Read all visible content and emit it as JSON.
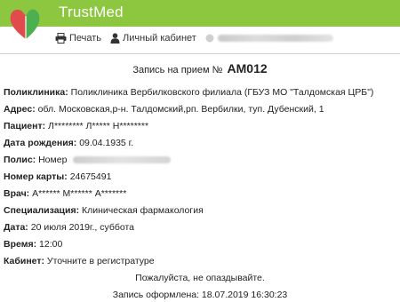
{
  "header": {
    "app_title": "TrustMed",
    "brand_color": "#8dc63f",
    "logo": {
      "icon": "heart-leaf-logo"
    }
  },
  "toolbar": {
    "print_label": "Печать",
    "print_icon": "printer-icon",
    "cabinet_label": "Личный кабинет",
    "cabinet_icon": "person-icon"
  },
  "appointment": {
    "title_prefix": "Запись на прием №",
    "number": "AM012",
    "fields": {
      "clinic_label": "Поликлиника:",
      "clinic_value": "Поликлиника Вербилковского филиала (ГБУЗ МО \"Талдомская ЦРБ\")",
      "address_label": "Адрес:",
      "address_value": "обл. Московская,р-н. Талдомский,рп. Вербилки, туп. Дубенский, 1",
      "patient_label": "Пациент:",
      "patient_value": "Л******** Л***** Н********",
      "birth_label": "Дата рождения:",
      "birth_value": "09.04.1935 г.",
      "policy_label": "Полис:",
      "policy_value": "Номер",
      "card_label": "Номер карты:",
      "card_value": "24675491",
      "doctor_label": "Врач:",
      "doctor_value": "А****** М****** А*******",
      "specialty_label": "Специализация:",
      "specialty_value": "Клиническая фармакология",
      "date_label": "Дата:",
      "date_value": "20 июля 2019г., суббота",
      "time_label": "Время:",
      "time_value": "12:00",
      "room_label": "Кабинет:",
      "room_value": "Уточните в регистратуре"
    },
    "reminder": "Пожалуйста, не опаздывайте.",
    "created": "Запись оформлена: 18.07.2019 16:30:23"
  }
}
